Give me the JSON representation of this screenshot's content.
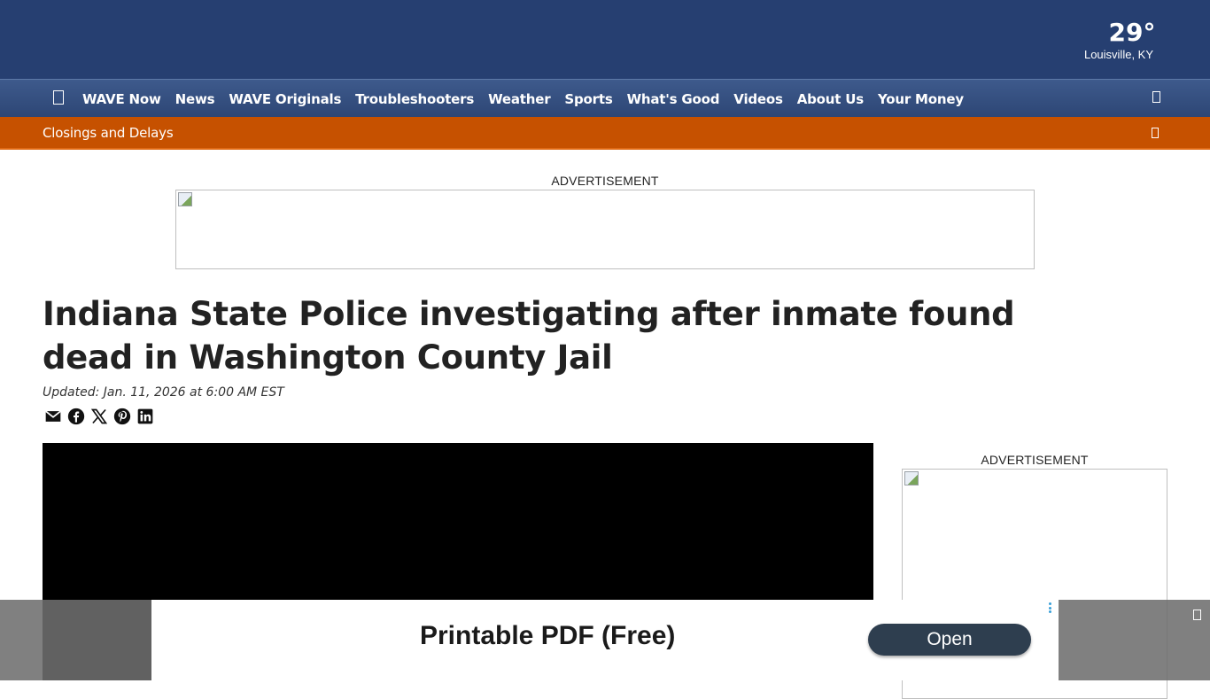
{
  "weather": {
    "temperature": "29°",
    "location": "Louisville, KY"
  },
  "nav": {
    "menu_icon": "menu-icon",
    "items": [
      "WAVE Now",
      "News",
      "WAVE Originals",
      "Troubleshooters",
      "Weather",
      "Sports",
      "What's Good",
      "Videos",
      "About Us",
      "Your Money"
    ],
    "search_icon": "search-icon"
  },
  "alert": {
    "label": "Closings and Delays",
    "icon": "chevron-icon"
  },
  "ads": {
    "top_label": "ADVERTISEMENT",
    "side_label": "ADVERTISEMENT"
  },
  "article": {
    "headline": "Indiana State Police investigating after inmate found dead in Washington County Jail",
    "updated": "Updated: Jan. 11, 2026 at 6:00 AM EST",
    "share_icons": [
      "email-icon",
      "facebook-icon",
      "x-icon",
      "pinterest-icon",
      "linkedin-icon"
    ]
  },
  "sticky_ad": {
    "text": "Printable PDF (Free)",
    "button_label": "Open"
  },
  "colors": {
    "header": "#263f71",
    "navbar": "#34507f",
    "alertbar": "#c65100",
    "ad_button": "#2e3e4f"
  }
}
